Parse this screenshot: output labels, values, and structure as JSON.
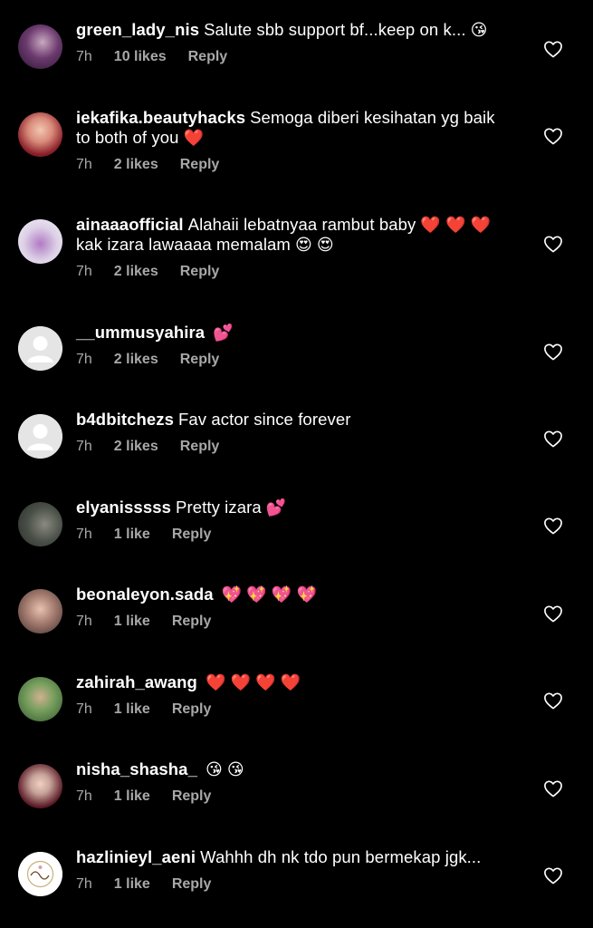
{
  "colors": {
    "background": "#000000",
    "text": "#ffffff",
    "meta": "#a8a8a8"
  },
  "comments": [
    {
      "username": "green_lady_nis",
      "text": "Salute sbb support bf...keep on k...",
      "emoji": "😘",
      "time": "7h",
      "likes": "10 likes",
      "reply": "Reply",
      "avatar": "photo-purple"
    },
    {
      "username": "iekafika.beautyhacks",
      "text": "Semoga diberi kesihatan yg baik to both of you",
      "emoji": "❤️",
      "time": "7h",
      "likes": "2 likes",
      "reply": "Reply",
      "avatar": "photo-hijab-red"
    },
    {
      "username": "ainaaaofficial",
      "text": "Alahaii lebatnyaa rambut baby",
      "emoji": "❤️ ❤️ ❤️",
      "text2": "kak izara lawaaaa memalam",
      "emoji2": "😍 😍",
      "time": "7h",
      "likes": "2 likes",
      "reply": "Reply",
      "avatar": "photo-light"
    },
    {
      "username": "__ummusyahira",
      "text": "",
      "emoji": "💕",
      "time": "7h",
      "likes": "2 likes",
      "reply": "Reply",
      "avatar": "default"
    },
    {
      "username": "b4dbitchezs",
      "text": "Fav actor since forever",
      "emoji": "",
      "time": "7h",
      "likes": "2 likes",
      "reply": "Reply",
      "avatar": "default"
    },
    {
      "username": "elyanisssss",
      "text": "Pretty izara",
      "emoji": "💕",
      "time": "7h",
      "likes": "1 like",
      "reply": "Reply",
      "avatar": "photo-grey"
    },
    {
      "username": "beonaleyon.sada",
      "text": "",
      "emoji": "💖 💖 💖 💖",
      "time": "7h",
      "likes": "1 like",
      "reply": "Reply",
      "avatar": "photo-warm"
    },
    {
      "username": "zahirah_awang",
      "text": "",
      "emoji": "❤️ ❤️ ❤️ ❤️",
      "time": "7h",
      "likes": "1 like",
      "reply": "Reply",
      "avatar": "photo-green"
    },
    {
      "username": "nisha_shasha_",
      "text": "",
      "emoji": "😘 😘",
      "time": "7h",
      "likes": "1 like",
      "reply": "Reply",
      "avatar": "photo-hijab-maroon"
    },
    {
      "username": "hazlinieyl_aeni",
      "text": "Wahhh dh nk tdo pun bermekap jgk...",
      "emoji": "",
      "time": "7h",
      "likes": "1 like",
      "reply": "Reply",
      "avatar": "logo-white"
    }
  ]
}
